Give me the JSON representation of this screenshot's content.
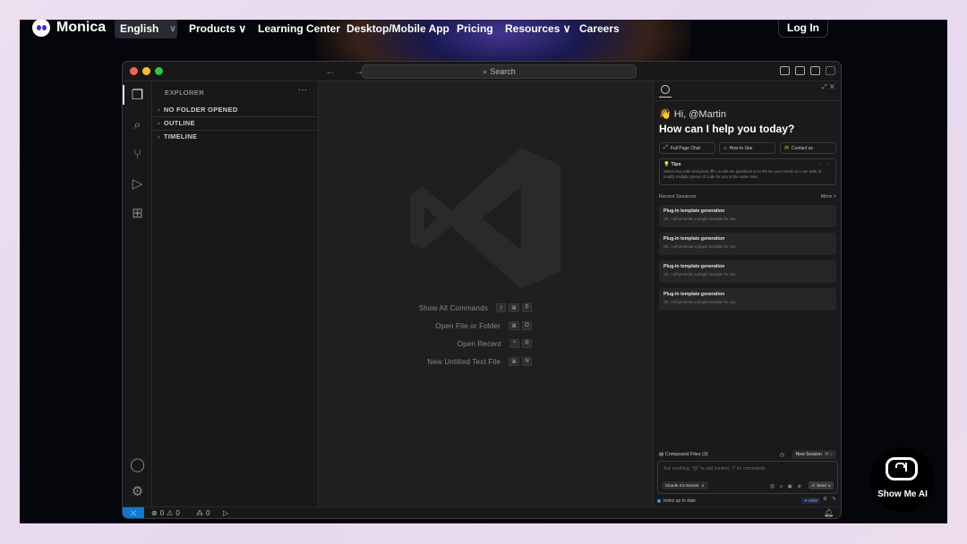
{
  "site": {
    "brand": "Monica",
    "language": "English",
    "nav": [
      "Products",
      "Learning Center",
      "Desktop/Mobile App",
      "Pricing",
      "Resources",
      "Careers"
    ],
    "login": "Log In"
  },
  "window": {
    "search_label": "Search",
    "nav_arrows": "← →"
  },
  "explorer": {
    "title": "EXPLORER",
    "more": "···",
    "sections": [
      "NO FOLDER OPENED",
      "OUTLINE",
      "TIMELINE"
    ]
  },
  "editor": {
    "commands": [
      {
        "label": "Show All Commands",
        "keys": [
          "⇧",
          "⌘",
          "P"
        ]
      },
      {
        "label": "Open File or Folder",
        "keys": [
          "⌘",
          "O"
        ]
      },
      {
        "label": "Open Recent",
        "keys": [
          "^",
          "R"
        ]
      },
      {
        "label": "New Untitled Text File",
        "keys": [
          "⌘",
          "N"
        ]
      }
    ]
  },
  "monica_panel": {
    "greeting": "👋 Hi, @Martin",
    "headline": "How can I help you today?",
    "buttons": [
      "Full Page Chat",
      "How to Use",
      "Contact us"
    ],
    "tips_title": "Tips",
    "tips_body": "Select any code and press ⌘ L to ask me questions or to tell me your needs so I can write or modify multiple pieces of code for you at the same time.",
    "recent_label": "Recent Sessions",
    "more_label": "More >",
    "sessions": [
      {
        "title": "Plug-in template generation",
        "subtitle": "Ok, I will generate a plugin template for you"
      },
      {
        "title": "Plug-in template generation",
        "subtitle": "Ok, I will generate a plugin template for you"
      },
      {
        "title": "Plug-in template generation",
        "subtitle": "Ok, I will generate a plugin template for you"
      },
      {
        "title": "Plug-in template generation",
        "subtitle": "Ok, I will generate a plugin template for you"
      }
    ],
    "composed_files": "Composed Files (3)",
    "new_session": "New Session",
    "new_session_shortcut": "⌘ L",
    "input_placeholder": "Ask anything, \"@\" to add context, \"/\" for commands",
    "model": "Claude 3.5 Sonnet",
    "send": "Send",
    "index_status": "Index up to date",
    "credits": "4500"
  },
  "statusbar": {
    "errors": "0",
    "warnings": "0",
    "ports": "0"
  },
  "badge": {
    "label": "Show Me AI"
  },
  "colors": {
    "accent": "#0e78d4",
    "background": "#1f1f1f"
  }
}
